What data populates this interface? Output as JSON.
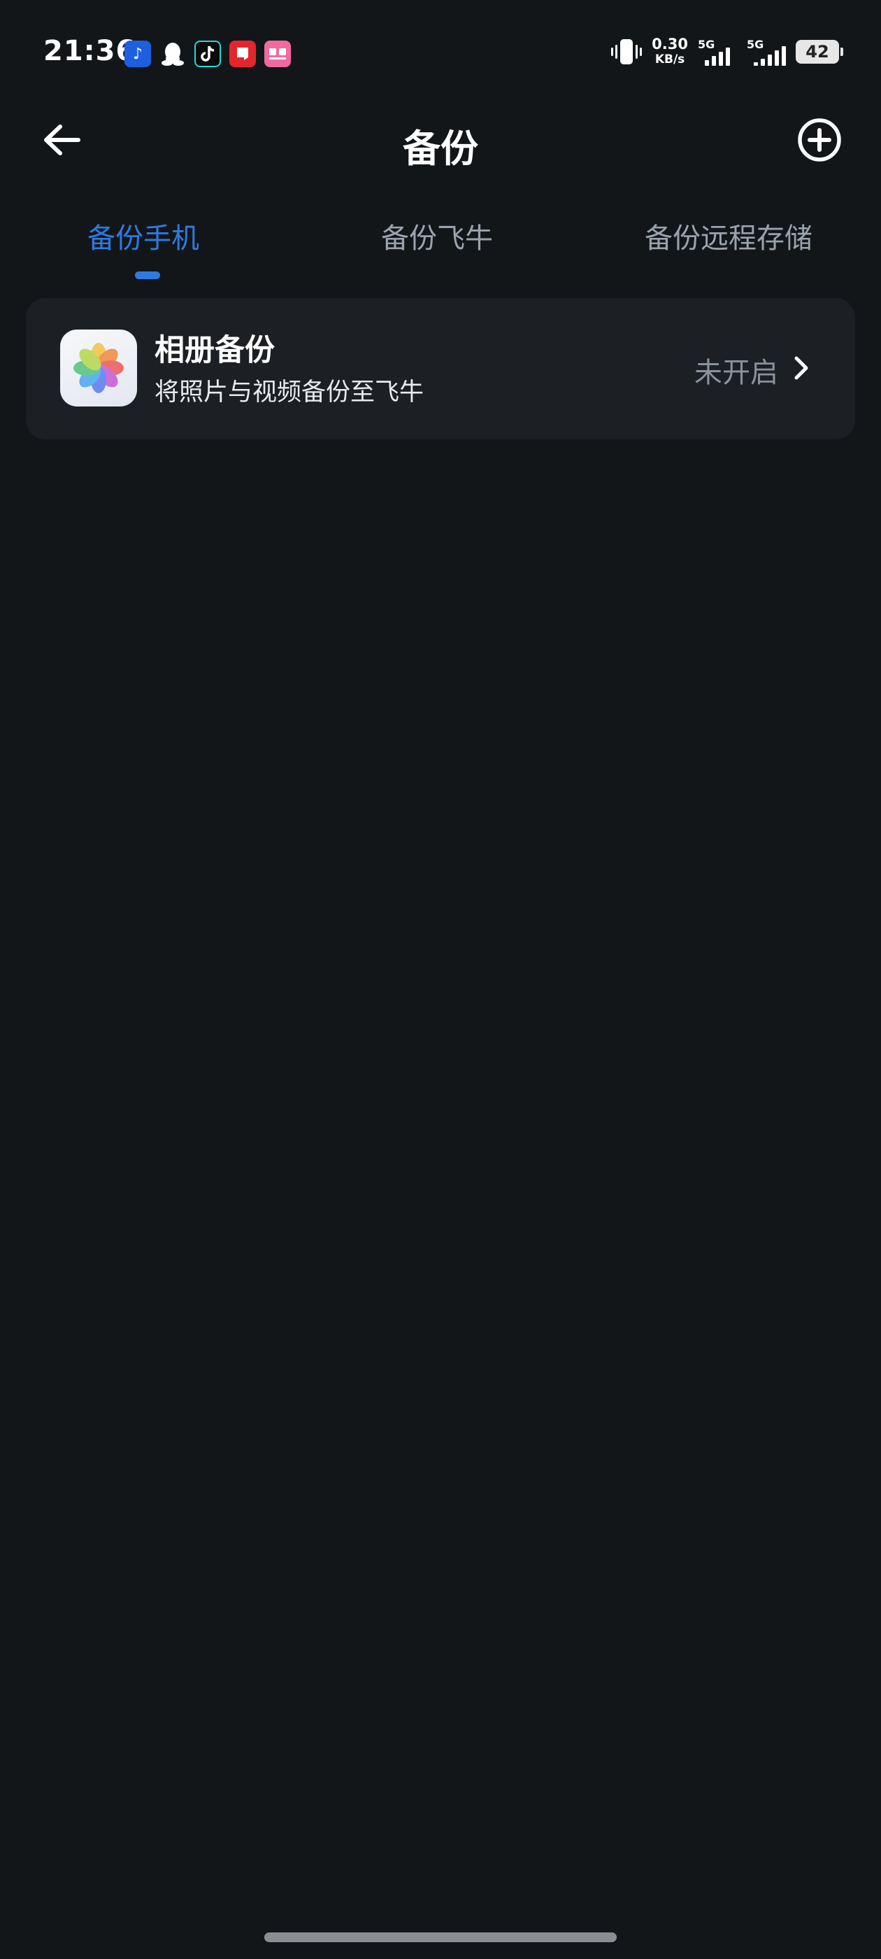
{
  "status_bar": {
    "time": "21:36",
    "net_speed_value": "0.30",
    "net_speed_unit": "KB/s",
    "sim1_label": "5G",
    "sim2_label": "5G",
    "battery": "42"
  },
  "header": {
    "title": "备份"
  },
  "tabs": [
    {
      "label": "备份手机",
      "active": true
    },
    {
      "label": "备份飞牛",
      "active": false
    },
    {
      "label": "备份远程存储",
      "active": false
    }
  ],
  "backup_item": {
    "title": "相册备份",
    "subtitle": "将照片与视频备份至飞牛",
    "status": "未开启"
  },
  "colors": {
    "background": "#131619",
    "card": "#1c1f24",
    "accent": "#2f7ae0",
    "muted": "#8a929c"
  }
}
